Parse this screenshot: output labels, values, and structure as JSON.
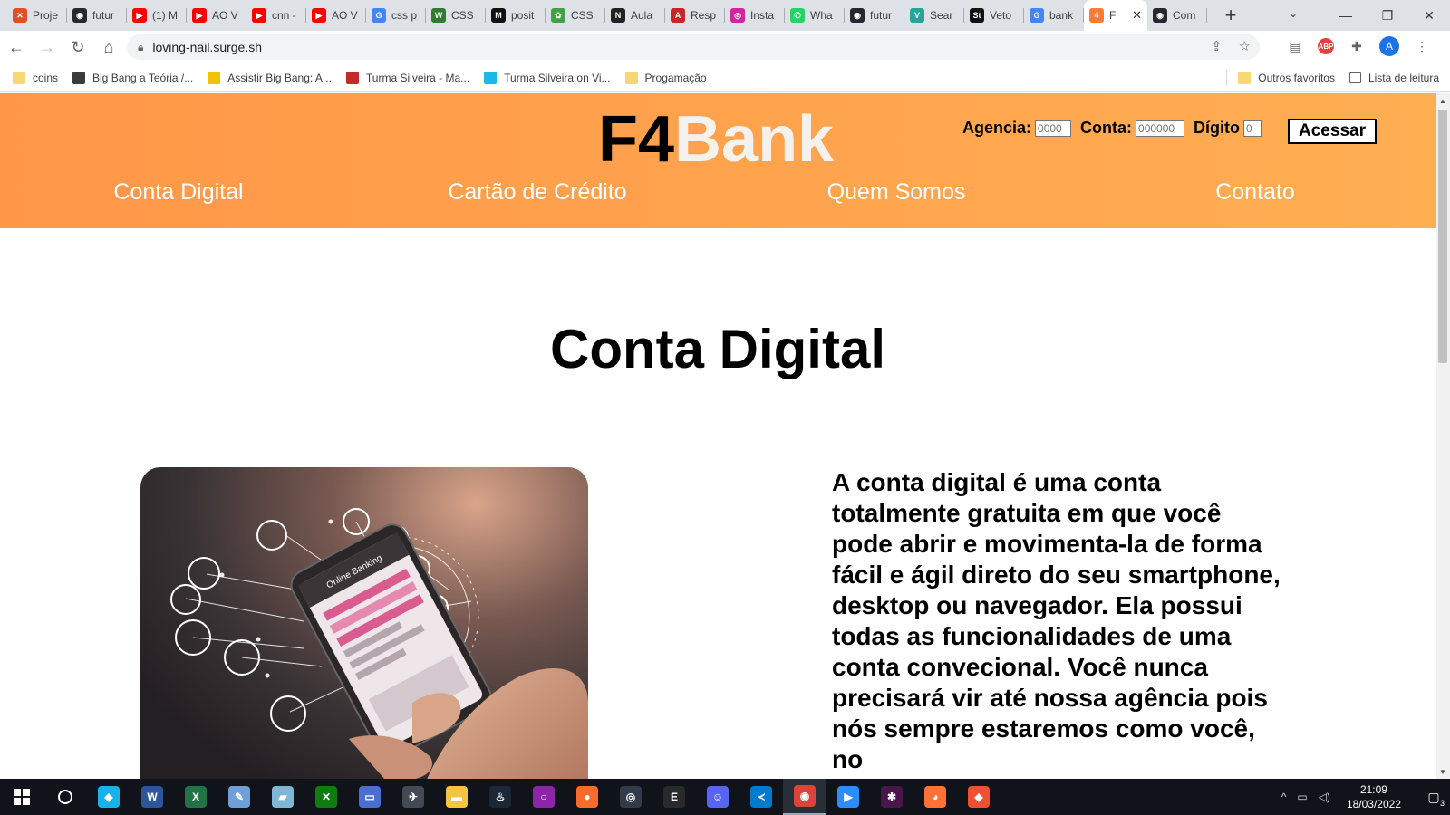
{
  "browser": {
    "tabs": [
      {
        "label": "Proje",
        "color": "#e44d26",
        "glyph": "✕"
      },
      {
        "label": "futur",
        "color": "#24292e",
        "glyph": "◉"
      },
      {
        "label": "(1) M",
        "color": "#ff0000",
        "glyph": "▶"
      },
      {
        "label": "AO V",
        "color": "#ff0000",
        "glyph": "▶"
      },
      {
        "label": "cnn -",
        "color": "#ff0000",
        "glyph": "▶"
      },
      {
        "label": "AO V",
        "color": "#ff0000",
        "glyph": "▶"
      },
      {
        "label": "css p",
        "color": "#4285f4",
        "glyph": "G"
      },
      {
        "label": "CSS",
        "color": "#2e7d32",
        "glyph": "W"
      },
      {
        "label": "posit",
        "color": "#111111",
        "glyph": "M"
      },
      {
        "label": "CSS",
        "color": "#43a047",
        "glyph": "✿"
      },
      {
        "label": "Aula",
        "color": "#222222",
        "glyph": "N"
      },
      {
        "label": "Resp",
        "color": "#c62828",
        "glyph": "A"
      },
      {
        "label": "Insta",
        "color": "#d6249f",
        "glyph": "◎"
      },
      {
        "label": "Wha",
        "color": "#25d366",
        "glyph": "✆"
      },
      {
        "label": "futur",
        "color": "#24292e",
        "glyph": "◉"
      },
      {
        "label": "Sear",
        "color": "#26a69a",
        "glyph": "V"
      },
      {
        "label": "Veto",
        "color": "#111111",
        "glyph": "St"
      },
      {
        "label": "bank",
        "color": "#4285f4",
        "glyph": "G"
      },
      {
        "label": "F",
        "color": "#ff7a33",
        "glyph": "4"
      },
      {
        "label": "Com",
        "color": "#24292e",
        "glyph": "◉"
      }
    ],
    "active_tab_index": 18,
    "url": "loving-nail.surge.sh",
    "bookmarks": [
      {
        "label": "coins",
        "color": "#f7d774"
      },
      {
        "label": "Big Bang a Teória /...",
        "color": "#3b3b3b"
      },
      {
        "label": "Assistir Big Bang: A...",
        "color": "#f2c200"
      },
      {
        "label": "Turma Silveira - Ma...",
        "color": "#c62828"
      },
      {
        "label": "Turma Silveira on Vi...",
        "color": "#1ab7ea"
      },
      {
        "label": "Progamação",
        "color": "#f7d774"
      }
    ],
    "other_bookmarks": "Outros favoritos",
    "reading_list": "Lista de leitura",
    "avatar_letter": "A"
  },
  "site": {
    "logo_part1": "F4",
    "logo_part2": "Bank",
    "login": {
      "agency_label": "Agencia:",
      "agency_placeholder": "0000",
      "account_label": "Conta:",
      "account_placeholder": "000000",
      "digit_label": "Dígito",
      "digit_placeholder": "0",
      "submit_label": "Acessar"
    },
    "nav": [
      "Conta Digital",
      "Cartão de Crédito",
      "Quem Somos",
      "Contato"
    ],
    "section_title": "Conta Digital",
    "description": "A conta digital é uma conta totalmente gratuita em que você pode abrir e movimenta-la de forma fácil e ágil direto do seu smartphone, desktop ou navegador. Ela possui todas as funcionalidades de uma conta convecional. Você nunca precisará vir até nossa agência pois nós sempre estaremos como você, no",
    "image_text": "Online Banking"
  },
  "taskbar": {
    "time": "21:09",
    "date": "18/03/2022",
    "notification_count": "3",
    "apps": [
      {
        "name": "kodi",
        "color": "#17b2e7",
        "glyph": "◆"
      },
      {
        "name": "word",
        "color": "#2b579a",
        "glyph": "W"
      },
      {
        "name": "excel",
        "color": "#217346",
        "glyph": "X"
      },
      {
        "name": "paint",
        "color": "#6f9fd8",
        "glyph": "✎"
      },
      {
        "name": "notes",
        "color": "#7fb6d6",
        "glyph": "▰"
      },
      {
        "name": "xbox",
        "color": "#107c10",
        "glyph": "✕"
      },
      {
        "name": "display",
        "color": "#4a6fd1",
        "glyph": "▭"
      },
      {
        "name": "satellite",
        "color": "#444a55",
        "glyph": "✈"
      },
      {
        "name": "explorer",
        "color": "#f4c542",
        "glyph": "▬"
      },
      {
        "name": "steam",
        "color": "#1b2838",
        "glyph": "♨"
      },
      {
        "name": "circle-app",
        "color": "#8e24aa",
        "glyph": "○"
      },
      {
        "name": "origin",
        "color": "#f56c2d",
        "glyph": "●"
      },
      {
        "name": "ubisoft",
        "color": "#333a4a",
        "glyph": "◎"
      },
      {
        "name": "epic",
        "color": "#2a2a2a",
        "glyph": "E"
      },
      {
        "name": "discord",
        "color": "#5865f2",
        "glyph": "☺"
      },
      {
        "name": "vscode",
        "color": "#007acc",
        "glyph": "≺"
      },
      {
        "name": "chrome",
        "color": "#db4437",
        "glyph": "◉"
      },
      {
        "name": "zoom",
        "color": "#2d8cff",
        "glyph": "▶"
      },
      {
        "name": "slack",
        "color": "#4a154b",
        "glyph": "✱"
      },
      {
        "name": "firefox",
        "color": "#ff7139",
        "glyph": "◕"
      },
      {
        "name": "git",
        "color": "#f05032",
        "glyph": "◆"
      }
    ],
    "active_app": "chrome"
  }
}
